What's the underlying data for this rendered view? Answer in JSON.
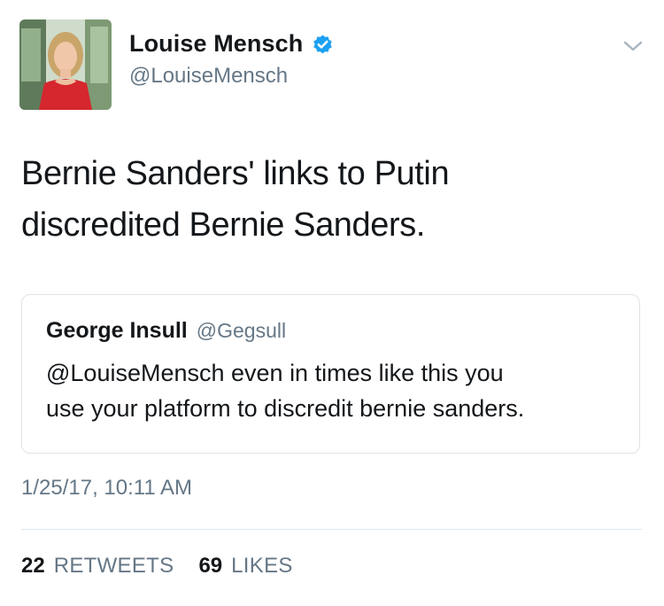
{
  "author": {
    "name": "Louise Mensch",
    "handle": "@LouiseMensch",
    "verified": true,
    "verified_color": "#1da1f2"
  },
  "tweet": {
    "text_lines": [
      "Bernie Sanders' links to Putin",
      "discredited Bernie Sanders."
    ]
  },
  "quoted_tweet": {
    "name": "George Insull",
    "handle": "@Gegsull",
    "text_lines": [
      "@LouiseMensch even in times like this you",
      "use your platform to discredit bernie sanders."
    ]
  },
  "timestamp": "1/25/17, 10:11 AM",
  "stats": {
    "retweets_count": "22",
    "retweets_label": "RETWEETS",
    "likes_count": "69",
    "likes_label": "LIKES"
  },
  "icons": {
    "avatar": "profile-photo",
    "verified": "verified-badge-icon",
    "more": "chevron-down-icon"
  }
}
